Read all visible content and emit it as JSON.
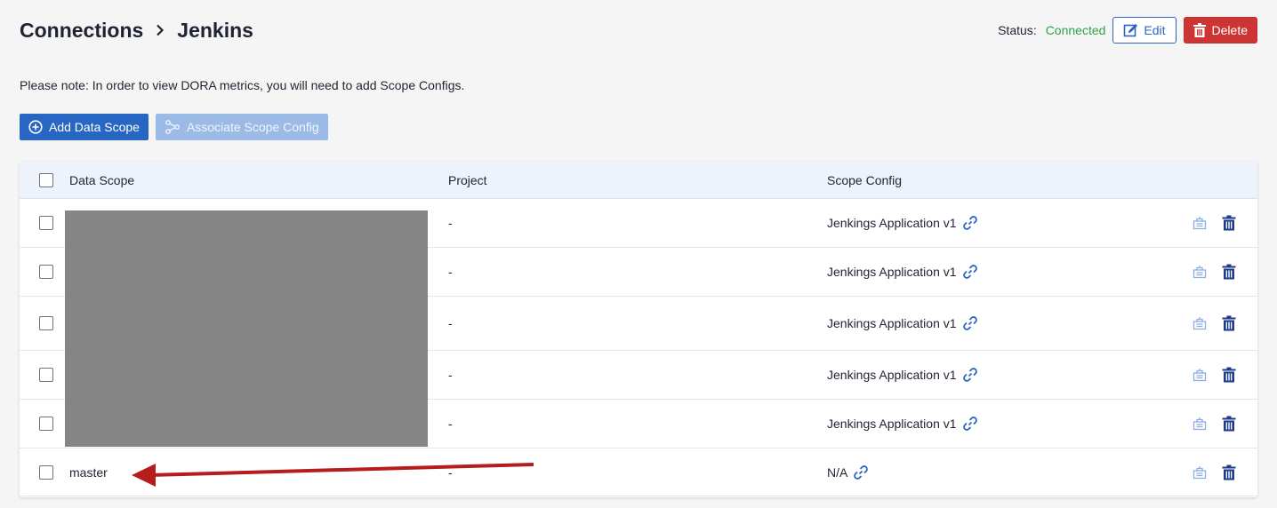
{
  "breadcrumb": {
    "root": "Connections",
    "current": "Jenkins"
  },
  "status": {
    "label": "Status:",
    "value": "Connected",
    "color": "#2ea34a"
  },
  "buttons": {
    "edit": "Edit",
    "delete": "Delete",
    "add_scope": "Add Data Scope",
    "associate": "Associate Scope Config"
  },
  "note": "Please note: In order to view DORA metrics, you will need to add Scope Configs.",
  "table": {
    "headers": {
      "scope": "Data Scope",
      "project": "Project",
      "config": "Scope Config"
    },
    "rows": [
      {
        "scope": "",
        "project": "-",
        "config": "Jenkings Application v1"
      },
      {
        "scope": "",
        "project": "-",
        "config": "Jenkings Application v1"
      },
      {
        "scope": "",
        "project": "-",
        "config": "Jenkings Application v1"
      },
      {
        "scope": "",
        "project": "-",
        "config": "Jenkings Application v1"
      },
      {
        "scope": "",
        "project": "-",
        "config": "Jenkings Application v1"
      },
      {
        "scope": "master",
        "project": "-",
        "config": "N/A"
      }
    ]
  },
  "colors": {
    "primary": "#2866c4",
    "danger": "#cd3535",
    "annotation_arrow": "#b71c1c",
    "redaction": "#858585"
  }
}
